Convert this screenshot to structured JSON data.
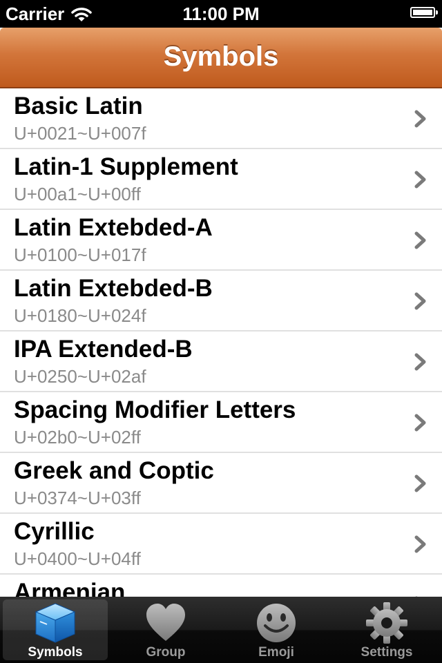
{
  "status_bar": {
    "carrier": "Carrier",
    "time": "11:00 PM",
    "wifi_icon": "wifi-icon",
    "battery_icon": "battery-icon"
  },
  "nav": {
    "title": "Symbols"
  },
  "list": {
    "items": [
      {
        "title": "Basic Latin",
        "range": "U+0021~U+007f"
      },
      {
        "title": "Latin-1 Supplement",
        "range": "U+00a1~U+00ff"
      },
      {
        "title": "Latin Extebded-A",
        "range": "U+0100~U+017f"
      },
      {
        "title": "Latin Extebded-B",
        "range": "U+0180~U+024f"
      },
      {
        "title": "IPA Extended-B",
        "range": "U+0250~U+02af"
      },
      {
        "title": "Spacing Modifier Letters",
        "range": "U+02b0~U+02ff"
      },
      {
        "title": "Greek and Coptic",
        "range": "U+0374~U+03ff"
      },
      {
        "title": "Cyrillic",
        "range": "U+0400~U+04ff"
      },
      {
        "title": "Armenian",
        "range": ""
      }
    ],
    "chevron_icon": "chevron-right-icon"
  },
  "tabs": [
    {
      "label": "Symbols",
      "icon": "box-icon",
      "selected": true
    },
    {
      "label": "Group",
      "icon": "heart-icon",
      "selected": false
    },
    {
      "label": "Emoji",
      "icon": "smiley-icon",
      "selected": false
    },
    {
      "label": "Settings",
      "icon": "gear-icon",
      "selected": false
    }
  ],
  "colors": {
    "nav_top": "#e7a06a",
    "nav_bottom": "#bf5a1d",
    "subtitle": "#8a8a8a",
    "tab_selected_icon": "#3aa0e8"
  }
}
